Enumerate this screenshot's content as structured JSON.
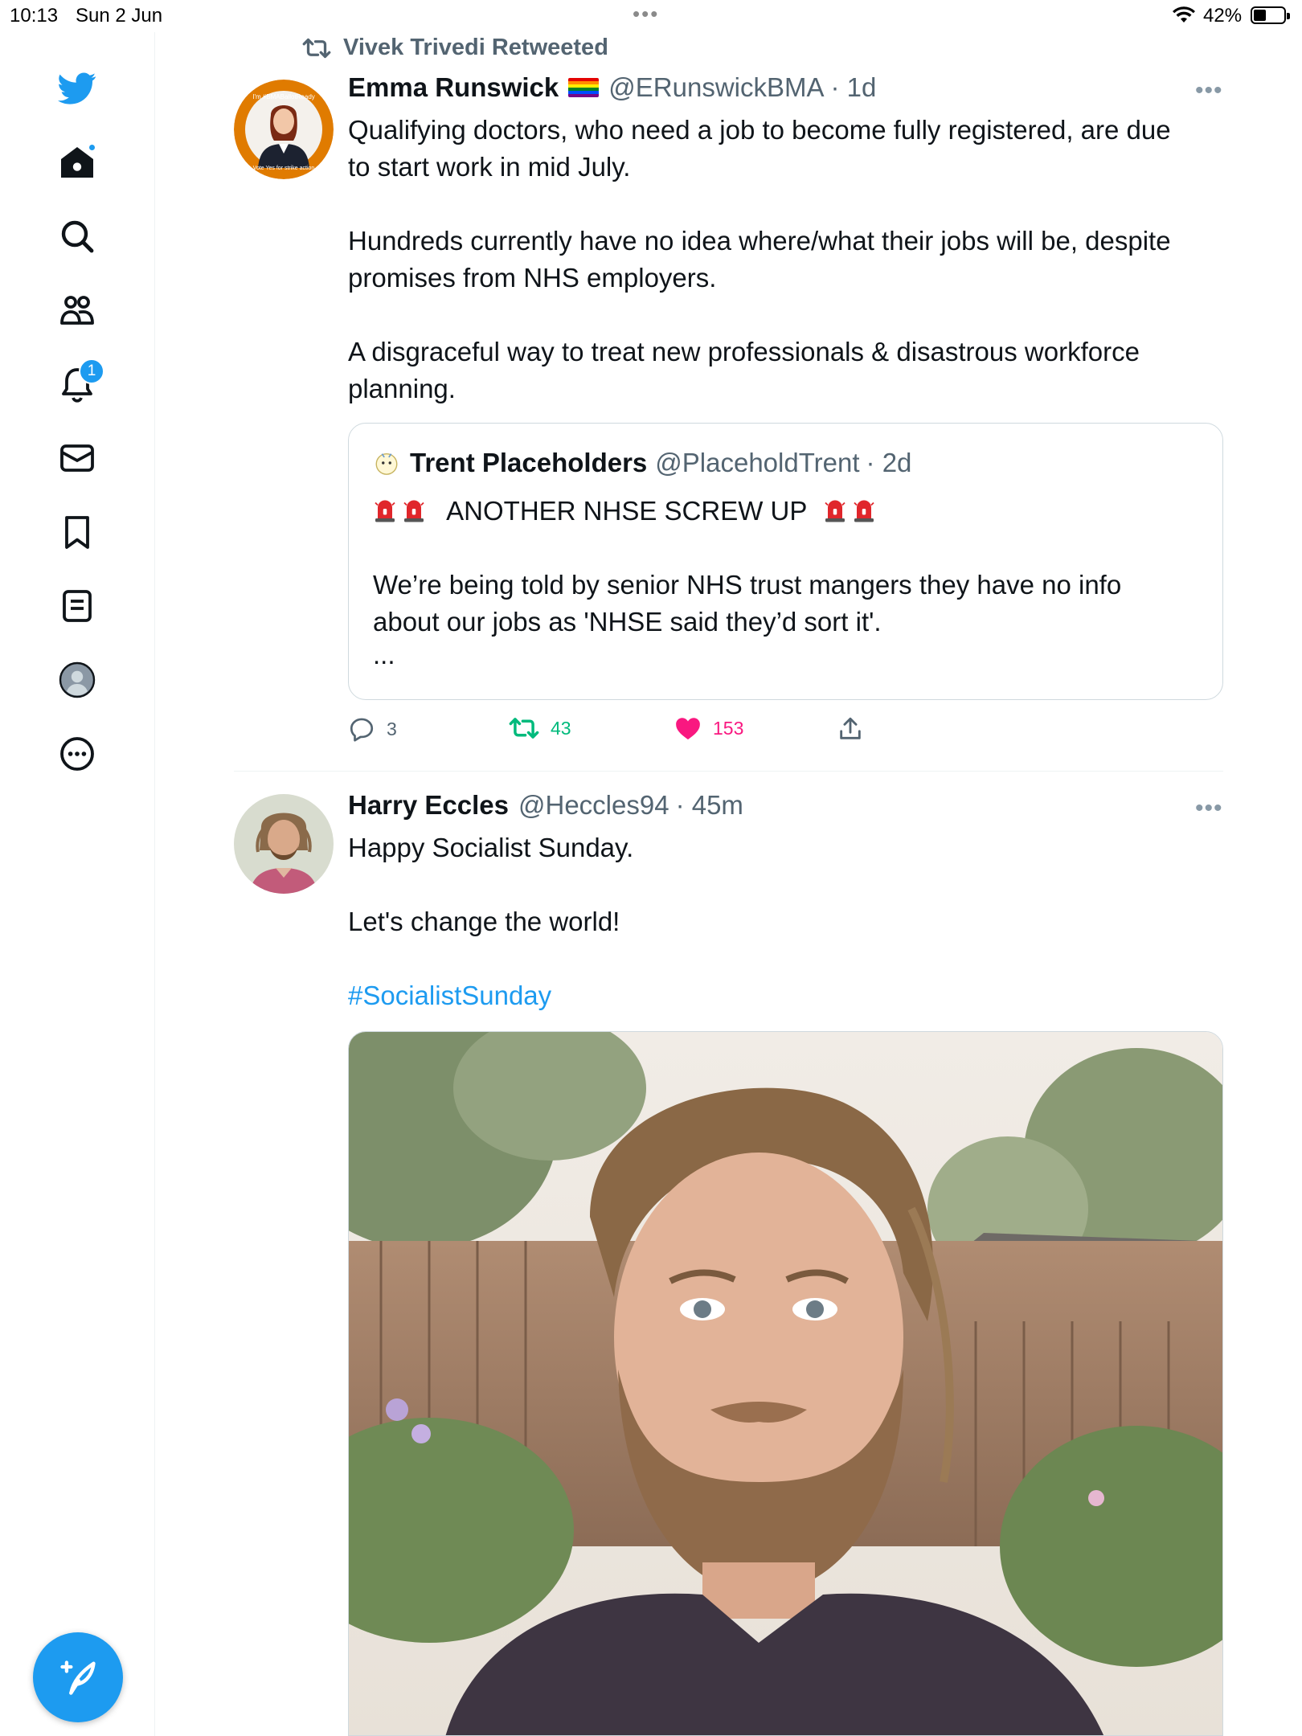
{
  "status_bar": {
    "time": "10:13",
    "date": "Sun 2 Jun",
    "battery": "42%",
    "battery_level": 0.42
  },
  "sidebar": {
    "items": [
      {
        "icon": "twitter-logo-icon"
      },
      {
        "icon": "home-icon",
        "has_dot": true
      },
      {
        "icon": "search-icon"
      },
      {
        "icon": "communities-icon"
      },
      {
        "icon": "notifications-icon",
        "badge": "1"
      },
      {
        "icon": "messages-icon"
      },
      {
        "icon": "bookmarks-icon"
      },
      {
        "icon": "lists-icon"
      },
      {
        "icon": "profile-icon"
      },
      {
        "icon": "more-icon"
      }
    ],
    "compose_icon": "compose-tweet-icon"
  },
  "tweets": [
    {
      "retweeted_by": "Vivek Trivedi Retweeted",
      "name": "Emma Runswick",
      "flag": "🏳️‍🌈",
      "handle": "@ERunswickBMA",
      "time": "· 1d",
      "paragraphs": [
        "Qualifying doctors, who need a job to become fully registered, are due",
        "to start work in mid July.",
        "",
        "Hundreds currently have no idea where/what their jobs will be, despite",
        "promises from NHS employers.",
        "",
        "A disgraceful way to treat new professionals & disastrous workforce",
        "planning."
      ],
      "quote": {
        "name": "Trent Placeholders",
        "handle": "@PlaceholdTrent",
        "time": "· 2d",
        "headline": "ANOTHER NHSE SCREW UP",
        "paragraphs": [
          "",
          "We’re being told by senior NHS trust mangers they have no info",
          "about our jobs as 'NHSE said they’d sort it'.",
          "..."
        ]
      },
      "actions": {
        "replies": "3",
        "retweets": "43",
        "likes": "153"
      },
      "colors": {
        "retweet": "#00ba7c",
        "like": "#f91880"
      }
    },
    {
      "name": "Harry Eccles",
      "handle": "@Heccles94",
      "time": "· 45m",
      "paragraphs": [
        "Happy Socialist Sunday.",
        "",
        "Let's change the world!",
        ""
      ],
      "hashtag": "#SocialistSunday"
    }
  ],
  "colors": {
    "accent": "#1d9bf0",
    "text": "#0f1419",
    "secondary": "#536471"
  }
}
